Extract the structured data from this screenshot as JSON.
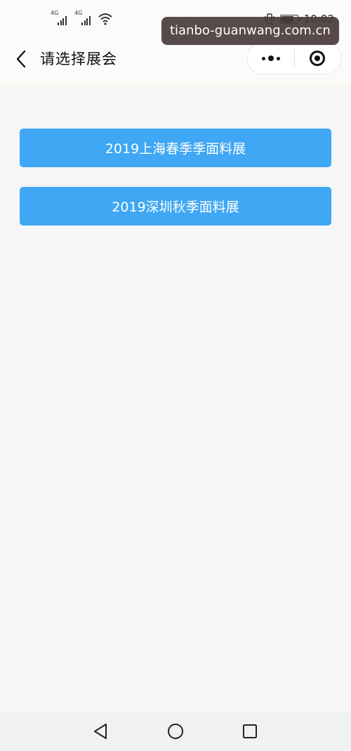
{
  "status_bar": {
    "sim1_label": "4G",
    "sim2_label": "4G",
    "time": "10:02",
    "icons": [
      "signal-icon",
      "wifi-icon",
      "vibrate-icon",
      "battery-icon"
    ]
  },
  "watermark": "tianbo-guanwang.com.cn",
  "header": {
    "title": "请选择展会",
    "back_icon": "chevron-left-icon",
    "more_icon": "more-dots-icon",
    "close_icon": "target-icon"
  },
  "exhibitions": [
    {
      "label": "2019上海春季季面料展"
    },
    {
      "label": "2019深圳秋季面料展"
    }
  ],
  "bottom_nav": {
    "icons": [
      "back-triangle-icon",
      "home-circle-icon",
      "recents-square-icon"
    ]
  },
  "colors": {
    "button": "#3fa7f3",
    "background": "#f6f5f8",
    "header": "#fbfafc",
    "bottom_bar": "#eff1f3"
  }
}
